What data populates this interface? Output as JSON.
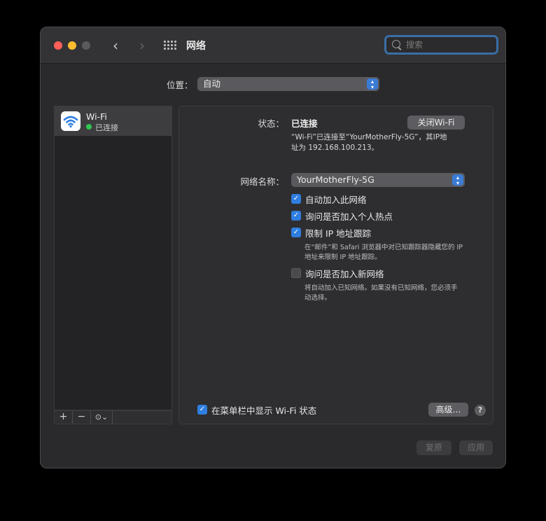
{
  "window": {
    "title": "网络"
  },
  "search": {
    "placeholder": "搜索"
  },
  "location": {
    "label": "位置：",
    "value": "自动"
  },
  "sidebar": {
    "services": [
      {
        "name": "Wi-Fi",
        "status": "已连接"
      }
    ],
    "toolbar": {
      "add": "+",
      "remove": "−",
      "action": "⊙⌄"
    }
  },
  "detail": {
    "status_label": "状态：",
    "status_value": "已连接",
    "turn_off_button": "关闭Wi-Fi",
    "status_desc_line1": "“Wi-Fi”已连接至“YourMotherFly-5G”，其IP地",
    "status_desc_line2": "址为 192.168.100.213。",
    "network_name_label": "网络名称：",
    "network_name_value": "YourMotherFly-5G",
    "options": [
      {
        "label": "自动加入此网络",
        "checked": true
      },
      {
        "label": "询问是否加入个人热点",
        "checked": true
      },
      {
        "label": "限制 IP 地址跟踪",
        "checked": true
      },
      {
        "label": "询问是否加入新网络",
        "checked": false
      }
    ],
    "limit_ip_desc_line1": "在“邮件”和 Safari 浏览器中对已知跟踪器隐藏您的 IP",
    "limit_ip_desc_line2": "地址来限制 IP 地址跟踪。",
    "ask_new_desc_line1": "将自动加入已知网络。如果没有已知网络，您必须手",
    "ask_new_desc_line2": "动选择。",
    "show_in_menubar": {
      "label": "在菜单栏中显示 Wi-Fi 状态",
      "checked": true
    },
    "advanced_button": "高级…",
    "help_button": "?"
  },
  "footer": {
    "revert_button": "复原",
    "apply_button": "应用"
  },
  "colors": {
    "accent": "#2f7ee0",
    "connected": "#2fc652"
  }
}
